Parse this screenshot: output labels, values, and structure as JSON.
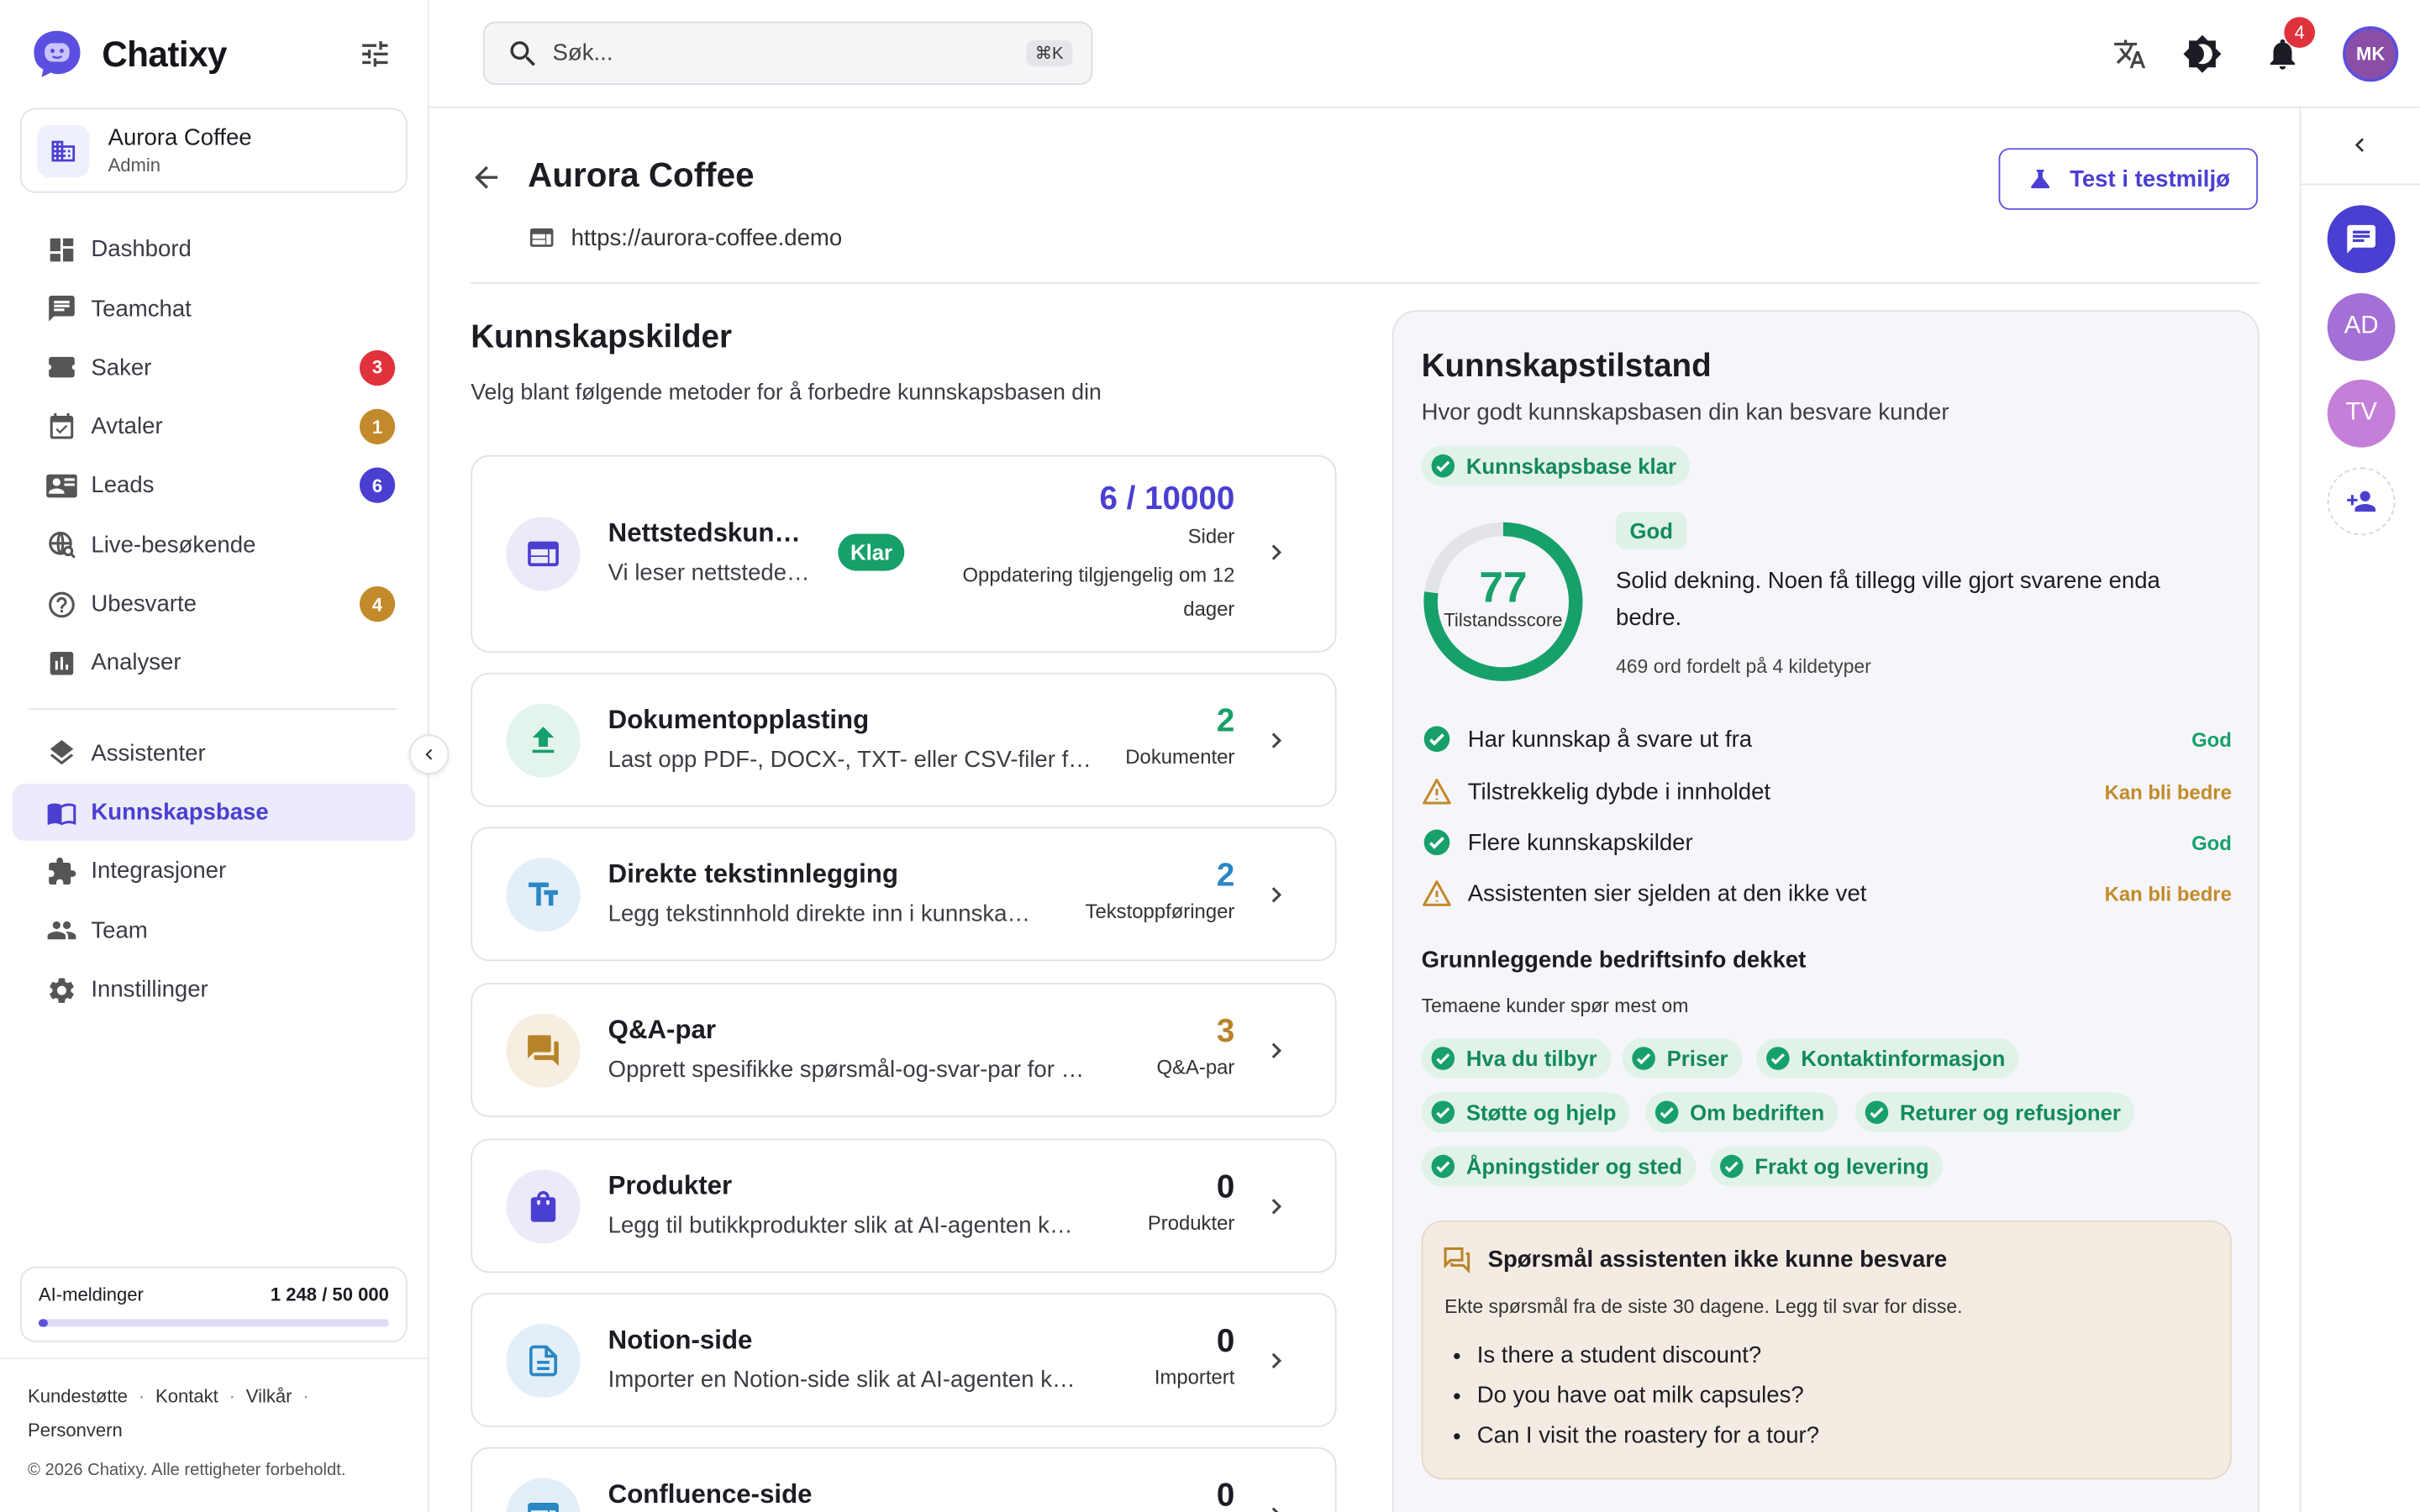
{
  "app": {
    "brand": "Chatixy"
  },
  "org": {
    "name": "Aurora Coffee",
    "role": "Admin"
  },
  "nav": {
    "items": [
      {
        "label": "Dashbord"
      },
      {
        "label": "Teamchat"
      },
      {
        "label": "Saker",
        "badge": "3",
        "badge_color": "#e0323c"
      },
      {
        "label": "Avtaler",
        "badge": "1",
        "badge_color": "#c28a2a"
      },
      {
        "label": "Leads",
        "badge": "6",
        "badge_color": "#4a3fd1"
      },
      {
        "label": "Live-besøkende"
      },
      {
        "label": "Ubesvarte",
        "badge": "4",
        "badge_color": "#c28a2a"
      },
      {
        "label": "Analyser"
      }
    ],
    "items2": [
      {
        "label": "Assistenter"
      },
      {
        "label": "Kunnskapsbase",
        "active": true
      },
      {
        "label": "Integrasjoner"
      },
      {
        "label": "Team"
      },
      {
        "label": "Innstillinger"
      }
    ]
  },
  "usage": {
    "label": "AI-meldinger",
    "value": "1 248 / 50 000",
    "fraction": 0.025
  },
  "footer": {
    "links": [
      "Kundestøtte",
      "Kontakt",
      "Vilkår",
      "Personvern"
    ],
    "copyright": "© 2026 Chatixy. Alle rettigheter forbeholdt."
  },
  "topbar": {
    "search_placeholder": "Søk...",
    "shortcut": "⌘K",
    "notifications": "4",
    "user_initials": "MK"
  },
  "page": {
    "title": "Aurora Coffee",
    "url": "https://aurora-coffee.demo",
    "test_button": "Test i testmiljø"
  },
  "sources": {
    "title": "Kunnskapskilder",
    "subtitle": "Velg blant følgende metoder for å forbedre kunnskapsbasen din",
    "items": [
      {
        "title": "Nettstedskun…",
        "desc": "Vi leser nettstede…",
        "count": "6 / 10000",
        "unit": "Sider",
        "status": "Klar",
        "update": "Oppdatering tilgjengelig om 12 dager",
        "color": "#4a3fd1",
        "icon": "web-icon"
      },
      {
        "title": "Dokumentopplasting",
        "desc": "Last opp PDF-, DOCX-, TXT- eller CSV-filer f…",
        "count": "2",
        "unit": "Dokumenter",
        "color": "#17a06a",
        "icon": "upload-icon"
      },
      {
        "title": "Direkte tekstinnlegging",
        "desc": "Legg tekstinnhold direkte inn i kunnska…",
        "count": "2",
        "unit": "Tekstoppføringer",
        "color": "#2b86c4",
        "icon": "text-icon"
      },
      {
        "title": "Q&A-par",
        "desc": "Opprett spesifikke spørsmål-og-svar-par for …",
        "count": "3",
        "unit": "Q&A-par",
        "color": "#b8842a",
        "icon": "forum-icon"
      },
      {
        "title": "Produkter",
        "desc": "Legg til butikkprodukter slik at AI-agenten k…",
        "count": "0",
        "unit": "Produkter",
        "color": "#1c1c24",
        "icon": "bag-icon"
      },
      {
        "title": "Notion-side",
        "desc": "Importer en Notion-side slik at AI-agenten k…",
        "count": "0",
        "unit": "Importert",
        "color": "#1c1c24",
        "icon": "document-icon"
      },
      {
        "title": "Confluence-side",
        "desc": "",
        "count": "0",
        "unit": "",
        "color": "#1c1c24",
        "icon": "web-icon"
      }
    ]
  },
  "health": {
    "title": "Kunnskapstilstand",
    "subtitle": "Hvor godt kunnskapsbasen din kan besvare kunder",
    "ready_chip": "Kunnskapsbase klar",
    "score": "77",
    "score_fraction": 0.77,
    "score_label": "Tilstandsscore",
    "rating": "God",
    "description": "Solid dekning. Noen få tillegg ville gjort svarene enda bedre.",
    "word_stats": "469 ord fordelt på 4 kildetyper",
    "checks": [
      {
        "label": "Har kunnskap å svare ut fra",
        "status": "God",
        "ok": true
      },
      {
        "label": "Tilstrekkelig dybde i innholdet",
        "status": "Kan bli bedre",
        "ok": false
      },
      {
        "label": "Flere kunnskapskilder",
        "status": "God",
        "ok": true
      },
      {
        "label": "Assistenten sier sjelden at den ikke vet",
        "status": "Kan bli bedre",
        "ok": false
      }
    ],
    "topics_title": "Grunnleggende bedriftsinfo dekket",
    "topics_subtitle": "Temaene kunder spør mest om",
    "topics": [
      "Hva du tilbyr",
      "Priser",
      "Kontaktinformasjon",
      "Støtte og hjelp",
      "Om bedriften",
      "Returer og refusjoner",
      "Åpningstider og sted",
      "Frakt og levering"
    ],
    "unanswered_title": "Spørsmål assistenten ikke kunne besvare",
    "unanswered_subtitle": "Ekte spørsmål fra de siste 30 dagene. Legg til svar for disse.",
    "unanswered": [
      "Is there a student discount?",
      "Do you have oat milk capsules?",
      "Can I visit the roastery for a tour?"
    ]
  },
  "rail": {
    "avatars": [
      {
        "initials": "AD",
        "color": "#a46fd6"
      },
      {
        "initials": "TV",
        "color": "#c47fd8"
      }
    ]
  },
  "colors": {
    "accent": "#4a3fd1",
    "success": "#17a06a",
    "warning": "#c28a2a",
    "danger": "#e0323c"
  }
}
